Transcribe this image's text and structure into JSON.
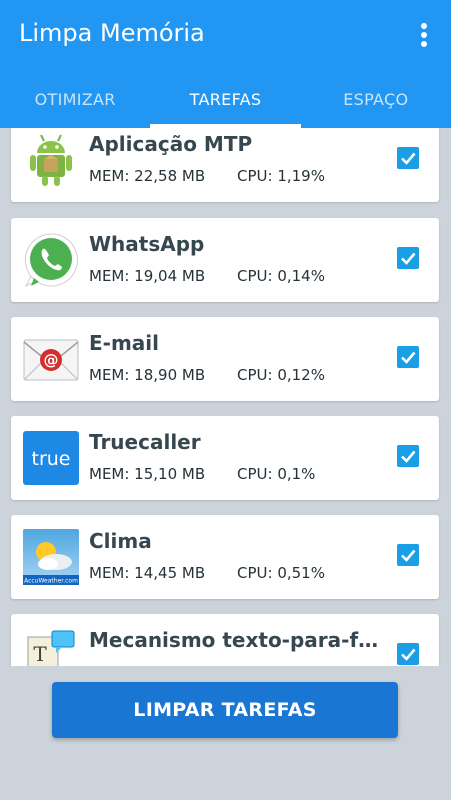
{
  "app_bar": {
    "title": "Limpa Memória",
    "menu_icon": "more-vert-icon"
  },
  "tabs": [
    {
      "label": "OTIMIZAR",
      "active": false
    },
    {
      "label": "TAREFAS",
      "active": true
    },
    {
      "label": "ESPAÇO",
      "active": false
    }
  ],
  "tasks": [
    {
      "name": "Aplicação MTP",
      "mem": "MEM: 22,58 MB",
      "cpu": "CPU: 1,19%",
      "icon": "android-icon",
      "checked": true
    },
    {
      "name": "WhatsApp",
      "mem": "MEM: 19,04 MB",
      "cpu": "CPU: 0,14%",
      "icon": "whatsapp-icon",
      "checked": true
    },
    {
      "name": "E-mail",
      "mem": "MEM: 18,90 MB",
      "cpu": "CPU: 0,12%",
      "icon": "email-icon",
      "checked": true
    },
    {
      "name": "Truecaller",
      "mem": "MEM: 15,10 MB",
      "cpu": "CPU: 0,1%",
      "icon": "truecaller-icon",
      "icon_text": "true",
      "checked": true
    },
    {
      "name": "Clima",
      "mem": "MEM: 14,45 MB",
      "cpu": "CPU: 0,51%",
      "icon": "weather-icon",
      "icon_text": "AccuWeather.com",
      "checked": true
    },
    {
      "name": "Mecanismo texto-para-fal…",
      "mem": "",
      "cpu": "",
      "icon": "text-to-speech-icon",
      "icon_text": "T",
      "checked": true
    }
  ],
  "action_button": {
    "label": "LIMPAR TAREFAS"
  },
  "colors": {
    "primary": "#2196f3",
    "accent": "#1a9ee6",
    "button": "#1976d2",
    "background": "#ccd3da"
  }
}
